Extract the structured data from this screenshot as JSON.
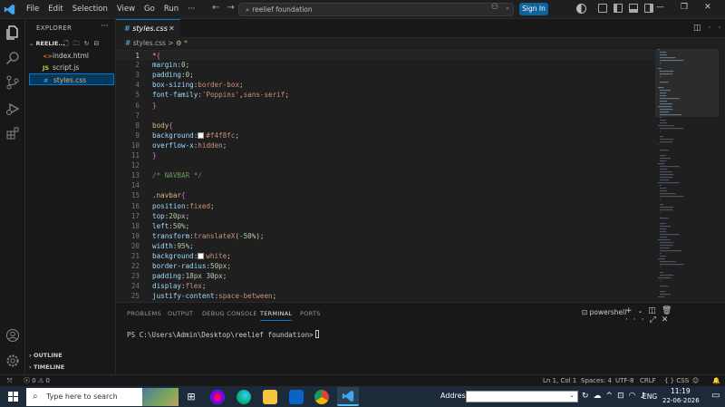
{
  "titlebar": {
    "menu": [
      "File",
      "Edit",
      "Selection",
      "View",
      "Go",
      "Run",
      "···"
    ],
    "search_text": "reelief foundation",
    "signin": "Sign In"
  },
  "sidebar": {
    "title": "EXPLORER",
    "folder": "REELIE...",
    "files": [
      {
        "icon": "<>",
        "name": "index.html",
        "color": "#e37933"
      },
      {
        "icon": "JS",
        "name": "script.js",
        "color": "#cbcb41"
      },
      {
        "icon": "#",
        "name": "styles.css",
        "color": "#519aba"
      }
    ],
    "outline": "OUTLINE",
    "timeline": "TIMELINE"
  },
  "tab": {
    "label": "styles.css"
  },
  "breadcrumb": {
    "file": "styles.css",
    "sep": ">",
    "sel": "*"
  },
  "editor": {
    "lines": [
      [
        {
          "t": "*",
          "c": "sel"
        },
        {
          "t": "{",
          "c": "brace"
        }
      ],
      [
        {
          "t": "margin",
          "c": "prop"
        },
        {
          "t": ":",
          "c": "pun"
        },
        {
          "t": "0",
          "c": "num"
        },
        {
          "t": ";",
          "c": "pun"
        }
      ],
      [
        {
          "t": "padding",
          "c": "prop"
        },
        {
          "t": ":",
          "c": "pun"
        },
        {
          "t": "0",
          "c": "num"
        },
        {
          "t": ";",
          "c": "pun"
        }
      ],
      [
        {
          "t": "box-sizing",
          "c": "prop"
        },
        {
          "t": ":",
          "c": "pun"
        },
        {
          "t": "border-box",
          "c": "val"
        },
        {
          "t": ";",
          "c": "pun"
        }
      ],
      [
        {
          "t": "font-family",
          "c": "prop"
        },
        {
          "t": ":",
          "c": "pun"
        },
        {
          "t": "'Poppins'",
          "c": "val"
        },
        {
          "t": ",",
          "c": "pun"
        },
        {
          "t": "sans-serif",
          "c": "val"
        },
        {
          "t": ";",
          "c": "pun"
        }
      ],
      [
        {
          "t": "}",
          "c": "brace"
        }
      ],
      [],
      [
        {
          "t": "body",
          "c": "sel"
        },
        {
          "t": "{",
          "c": "brace"
        }
      ],
      [
        {
          "t": "background",
          "c": "prop"
        },
        {
          "t": ":",
          "c": "pun"
        },
        {
          "t": "",
          "c": "swatch",
          "color": "#f4f8fc"
        },
        {
          "t": "#f4f8fc",
          "c": "val"
        },
        {
          "t": ";",
          "c": "pun"
        }
      ],
      [
        {
          "t": "overflow-x",
          "c": "prop"
        },
        {
          "t": ":",
          "c": "pun"
        },
        {
          "t": "hidden",
          "c": "val"
        },
        {
          "t": ";",
          "c": "pun"
        }
      ],
      [
        {
          "t": "}",
          "c": "brace"
        }
      ],
      [],
      [
        {
          "t": "/* NAVBAR */",
          "c": "cmt"
        }
      ],
      [],
      [
        {
          "t": ".navbar",
          "c": "sel"
        },
        {
          "t": "{",
          "c": "brace"
        }
      ],
      [
        {
          "t": "position",
          "c": "prop"
        },
        {
          "t": ":",
          "c": "pun"
        },
        {
          "t": "fixed",
          "c": "val"
        },
        {
          "t": ";",
          "c": "pun"
        }
      ],
      [
        {
          "t": "top",
          "c": "prop"
        },
        {
          "t": ":",
          "c": "pun"
        },
        {
          "t": "20px",
          "c": "num"
        },
        {
          "t": ";",
          "c": "pun"
        }
      ],
      [
        {
          "t": "left",
          "c": "prop"
        },
        {
          "t": ":",
          "c": "pun"
        },
        {
          "t": "50%",
          "c": "num"
        },
        {
          "t": ";",
          "c": "pun"
        }
      ],
      [
        {
          "t": "transform",
          "c": "prop"
        },
        {
          "t": ":",
          "c": "pun"
        },
        {
          "t": "translateX",
          "c": "val"
        },
        {
          "t": "(",
          "c": "pun"
        },
        {
          "t": "-50%",
          "c": "num"
        },
        {
          "t": ");",
          "c": "pun"
        }
      ],
      [
        {
          "t": "width",
          "c": "prop"
        },
        {
          "t": ":",
          "c": "pun"
        },
        {
          "t": "95%",
          "c": "num"
        },
        {
          "t": ";",
          "c": "pun"
        }
      ],
      [
        {
          "t": "background",
          "c": "prop"
        },
        {
          "t": ":",
          "c": "pun"
        },
        {
          "t": "",
          "c": "swatch",
          "color": "#ffffff"
        },
        {
          "t": "white",
          "c": "val"
        },
        {
          "t": ";",
          "c": "pun"
        }
      ],
      [
        {
          "t": "border-radius",
          "c": "prop"
        },
        {
          "t": ":",
          "c": "pun"
        },
        {
          "t": "50px",
          "c": "num"
        },
        {
          "t": ";",
          "c": "pun"
        }
      ],
      [
        {
          "t": "padding",
          "c": "prop"
        },
        {
          "t": ":",
          "c": "pun"
        },
        {
          "t": "18px 30px",
          "c": "num"
        },
        {
          "t": ";",
          "c": "pun"
        }
      ],
      [
        {
          "t": "display",
          "c": "prop"
        },
        {
          "t": ":",
          "c": "pun"
        },
        {
          "t": "flex",
          "c": "val"
        },
        {
          "t": ";",
          "c": "pun"
        }
      ],
      [
        {
          "t": "justify-content",
          "c": "prop"
        },
        {
          "t": ":",
          "c": "pun"
        },
        {
          "t": "space-between",
          "c": "val"
        },
        {
          "t": ";",
          "c": "pun"
        }
      ]
    ]
  },
  "panel": {
    "tabs": [
      "PROBLEMS",
      "OUTPUT",
      "DEBUG CONSOLE",
      "TERMINAL",
      "PORTS"
    ],
    "active_tab": "TERMINAL",
    "shell": "powershell",
    "prompt": "PS C:\\Users\\Admin\\Desktop\\reelief foundation>"
  },
  "status": {
    "errors": "0",
    "warnings": "0",
    "position": "Ln 1, Col 1",
    "spaces": "Spaces: 4",
    "encoding": "UTF-8",
    "eol": "CRLF",
    "language": "CSS"
  },
  "taskbar": {
    "search_placeholder": "Type here to search",
    "address_label": "Address",
    "lang": "ENG",
    "time": "11:19",
    "date": "22-06-2026"
  }
}
